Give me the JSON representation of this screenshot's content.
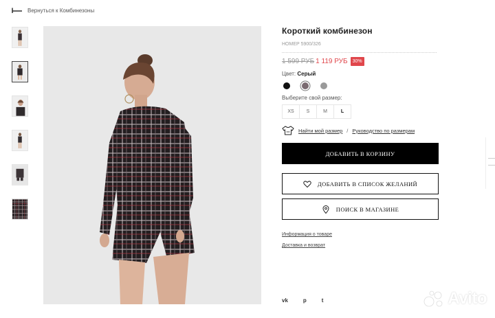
{
  "nav": {
    "back_label": "Вернуться к Комбинезоны"
  },
  "product": {
    "title": "Короткий комбинезон",
    "sku": "НОМЕР 5900/326",
    "old_price": "1 599 РУБ",
    "new_price": "1 119 РУБ",
    "discount": "30%",
    "color_label": "Цвет:",
    "color_value": "Серый",
    "colors": [
      {
        "name": "black",
        "hex": "#111111"
      },
      {
        "name": "plaid",
        "hex": "#7a6a70"
      },
      {
        "name": "grey",
        "hex": "#9a9a9a"
      }
    ],
    "size_label": "Выберите свой размер:",
    "sizes": [
      "XS",
      "S",
      "M",
      "L"
    ],
    "selected_size": "L"
  },
  "guide": {
    "find_size": "Найти мой размер",
    "separator": "/",
    "size_guide": "Руководство по размерам"
  },
  "buttons": {
    "add_to_cart": "ДОБАВИТЬ В КОРЗИНУ",
    "wishlist": "ДОБАВИТЬ В СПИСОК ЖЕЛАНИЙ",
    "find_in_store": "ПОИСК В МАГАЗИНЕ"
  },
  "links": {
    "product_info": "Информация о товаре",
    "delivery": "Доставка и возврат"
  },
  "social": {
    "vk": "vk",
    "pinterest": "p",
    "twitter": "t"
  },
  "watermark": "Avito",
  "colors": {
    "accent_red": "#e0464b",
    "primary_button": "#000000"
  }
}
